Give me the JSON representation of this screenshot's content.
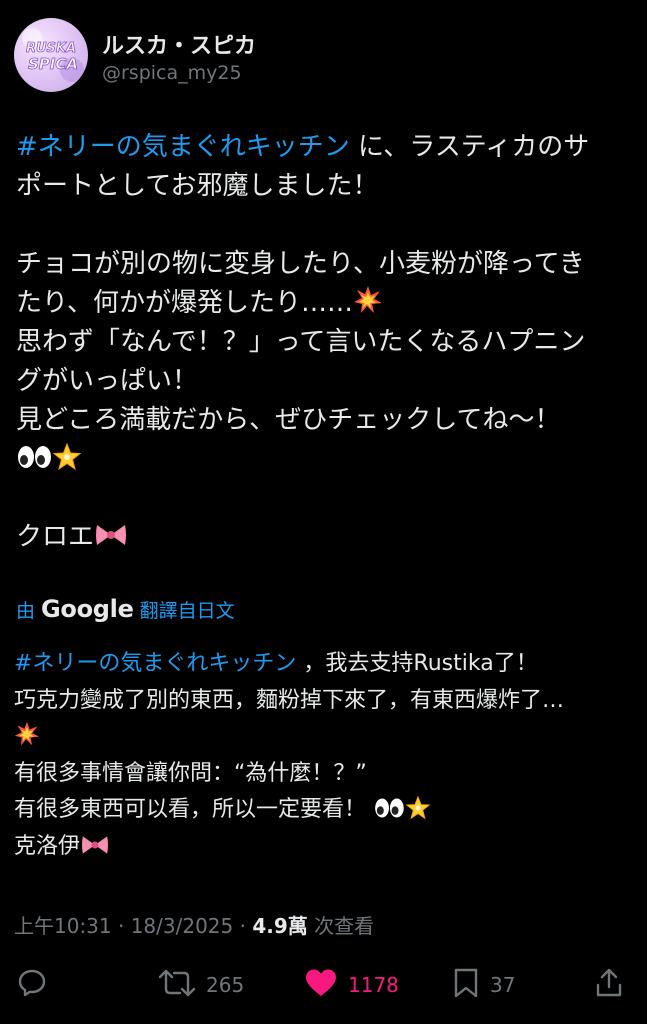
{
  "author": {
    "display_name": "ルスカ・スピカ",
    "handle": "@rspica_my25",
    "avatar_logo_text": [
      "RUSKA",
      "SPICA"
    ]
  },
  "post": {
    "hashtag": "#ネリーの気まぐれキッチン",
    "line1_rest": " に、ラスティカのサ",
    "line2": "ポートとしてお邪魔しました！",
    "line3": "チョコが別の物に変身したり、小麦粉が降ってき",
    "line4": "たり、何かが爆発したり……",
    "line5": "思わず「なんで！？」って言いたくなるハプニン",
    "line6": "グがいっぱい！",
    "line7": "見どころ満載だから、ぜひチェックしてね～！",
    "signature": "クロエ"
  },
  "translation": {
    "by_label": "由",
    "provider": "Google",
    "from_label": "翻譯自日文",
    "hashtag": "#ネリーの気まぐれキッチン",
    "line1_rest": " ，我去支持Rustika了！",
    "line2": "巧克力變成了別的東西，麵粉掉下來了，有東西爆炸了…",
    "line3": "有很多事情會讓你問：“為什麼！？”",
    "line4": "有很多東西可以看，所以一定要看！ ",
    "signature": "克洛伊"
  },
  "meta": {
    "time_date": "上午10:31 · 18/3/2025 · ",
    "views_count": "4.9萬",
    "views_label": " 次查看"
  },
  "actions": {
    "reply_icon": "reply-icon",
    "retweet_icon": "retweet-icon",
    "retweet_count": "265",
    "like_icon": "heart-filled-icon",
    "like_count": "1178",
    "bookmark_icon": "bookmark-icon",
    "bookmark_count": "37",
    "share_icon": "share-icon"
  },
  "colors": {
    "background": "#000000",
    "text": "#e7e9ea",
    "secondary": "#71767b",
    "link": "#1d9bf0",
    "like": "#f91880"
  }
}
